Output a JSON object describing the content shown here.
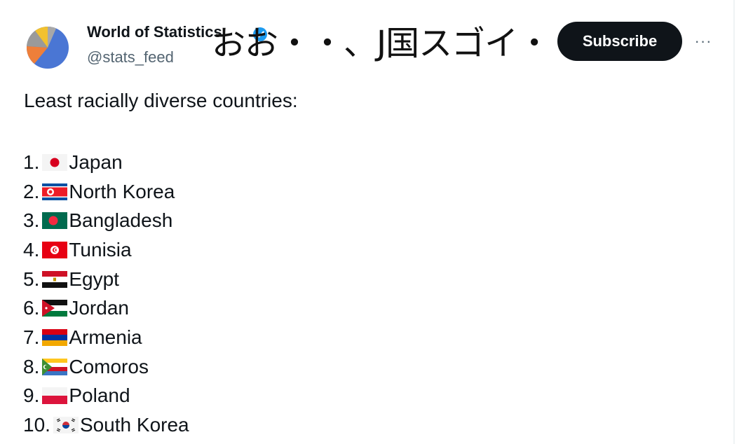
{
  "account": {
    "name": "World of Statistics",
    "handle": "@stats_feed"
  },
  "overlay_text": "おお・・、J国スゴイ・・・",
  "subscribe_label": "Subscribe",
  "more_label": "···",
  "tweet": {
    "intro": "Least racially diverse countries:",
    "items": [
      {
        "num": "1.",
        "flag": "japan-flag-icon",
        "label": "Japan"
      },
      {
        "num": "2.",
        "flag": "north-korea-flag-icon",
        "label": "North Korea"
      },
      {
        "num": "3.",
        "flag": "bangladesh-flag-icon",
        "label": "Bangladesh"
      },
      {
        "num": "4.",
        "flag": "tunisia-flag-icon",
        "label": "Tunisia"
      },
      {
        "num": "5.",
        "flag": "egypt-flag-icon",
        "label": "Egypt"
      },
      {
        "num": "6.",
        "flag": "jordan-flag-icon",
        "label": "Jordan"
      },
      {
        "num": "7.",
        "flag": "armenia-flag-icon",
        "label": "Armenia"
      },
      {
        "num": "8.",
        "flag": "comoros-flag-icon",
        "label": "Comoros"
      },
      {
        "num": "9.",
        "flag": "poland-flag-icon",
        "label": "Poland"
      },
      {
        "num": "10.",
        "flag": "south-korea-flag-icon",
        "label": "South Korea"
      }
    ]
  },
  "colors": {
    "subscribe_bg": "#0f1419",
    "handle": "#536471",
    "verified": "#1d9bf0"
  }
}
